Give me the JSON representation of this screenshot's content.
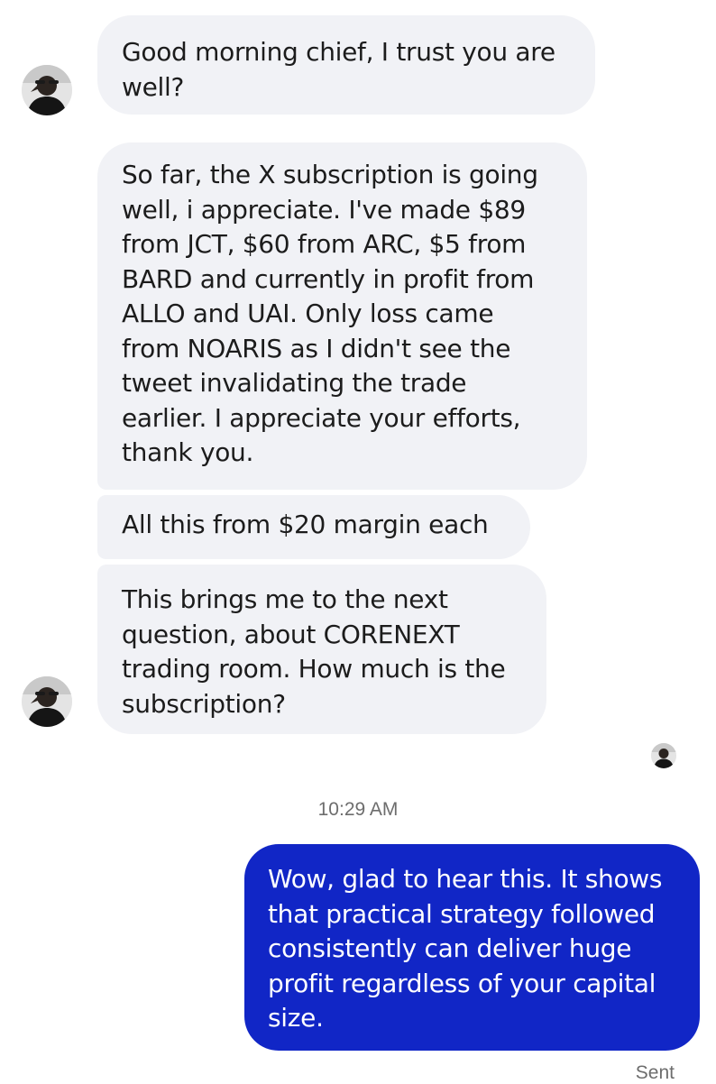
{
  "conversation": {
    "incoming_messages": [
      {
        "text": "Good morning chief, I trust you are\nwell?"
      },
      {
        "text": "So far, the X subscription is going\nwell, i appreciate. I've made $89\nfrom JCT, $60 from ARC, $5 from\nBARD and currently in profit from\nALLO and UAI. Only loss came\nfrom NOARIS as I didn't see the\ntweet invalidating the trade\nearlier. I appreciate your efforts,\nthank you."
      },
      {
        "text": "All this from $20 margin each"
      },
      {
        "text": "This brings me to the next\nquestion, about CORENEXT\ntrading room. How much is the\nsubscription?"
      }
    ],
    "timestamp": "10:29 AM",
    "outgoing_messages": [
      {
        "text": "Wow, glad to hear this. It shows\nthat practical strategy followed\nconsistently can deliver huge\nprofit regardless of your capital\nsize."
      }
    ],
    "delivery_status": "Sent"
  },
  "theme": {
    "incoming_bubble_color": "#f1f2f6",
    "outgoing_bubble_color": "#1126c6",
    "outgoing_text_color": "#ffffff"
  }
}
